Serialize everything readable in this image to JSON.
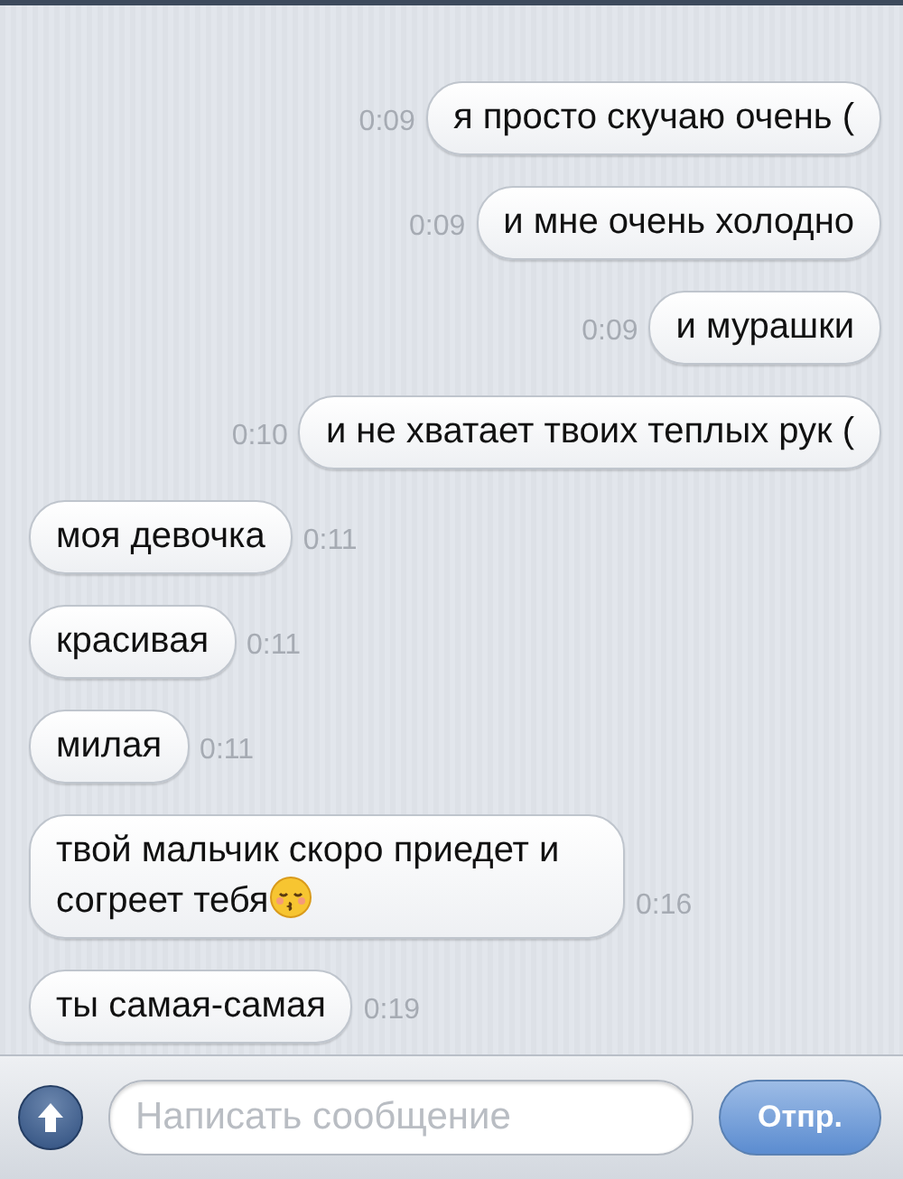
{
  "messages": [
    {
      "kind": "outgoing",
      "text": "я просто скучаю очень (",
      "time": "0:09"
    },
    {
      "kind": "outgoing",
      "text": "и мне очень холодно",
      "time": "0:09"
    },
    {
      "kind": "outgoing",
      "text": "и мурашки",
      "time": "0:09"
    },
    {
      "kind": "outgoing",
      "text": "и не хватает твоих теплых рук (",
      "time": "0:10"
    },
    {
      "kind": "incoming",
      "text": "моя девочка",
      "time": "0:11"
    },
    {
      "kind": "incoming",
      "text": "красивая",
      "time": "0:11"
    },
    {
      "kind": "incoming",
      "text": "милая",
      "time": "0:11"
    },
    {
      "kind": "incoming_emoji",
      "text": "твой мальчик скоро приедет и согреет тебя",
      "time": "0:16"
    },
    {
      "kind": "incoming",
      "text": "ты самая-самая",
      "time": "0:19"
    }
  ],
  "composer": {
    "placeholder": "Написать сообщение",
    "send_button": "Отпр."
  }
}
